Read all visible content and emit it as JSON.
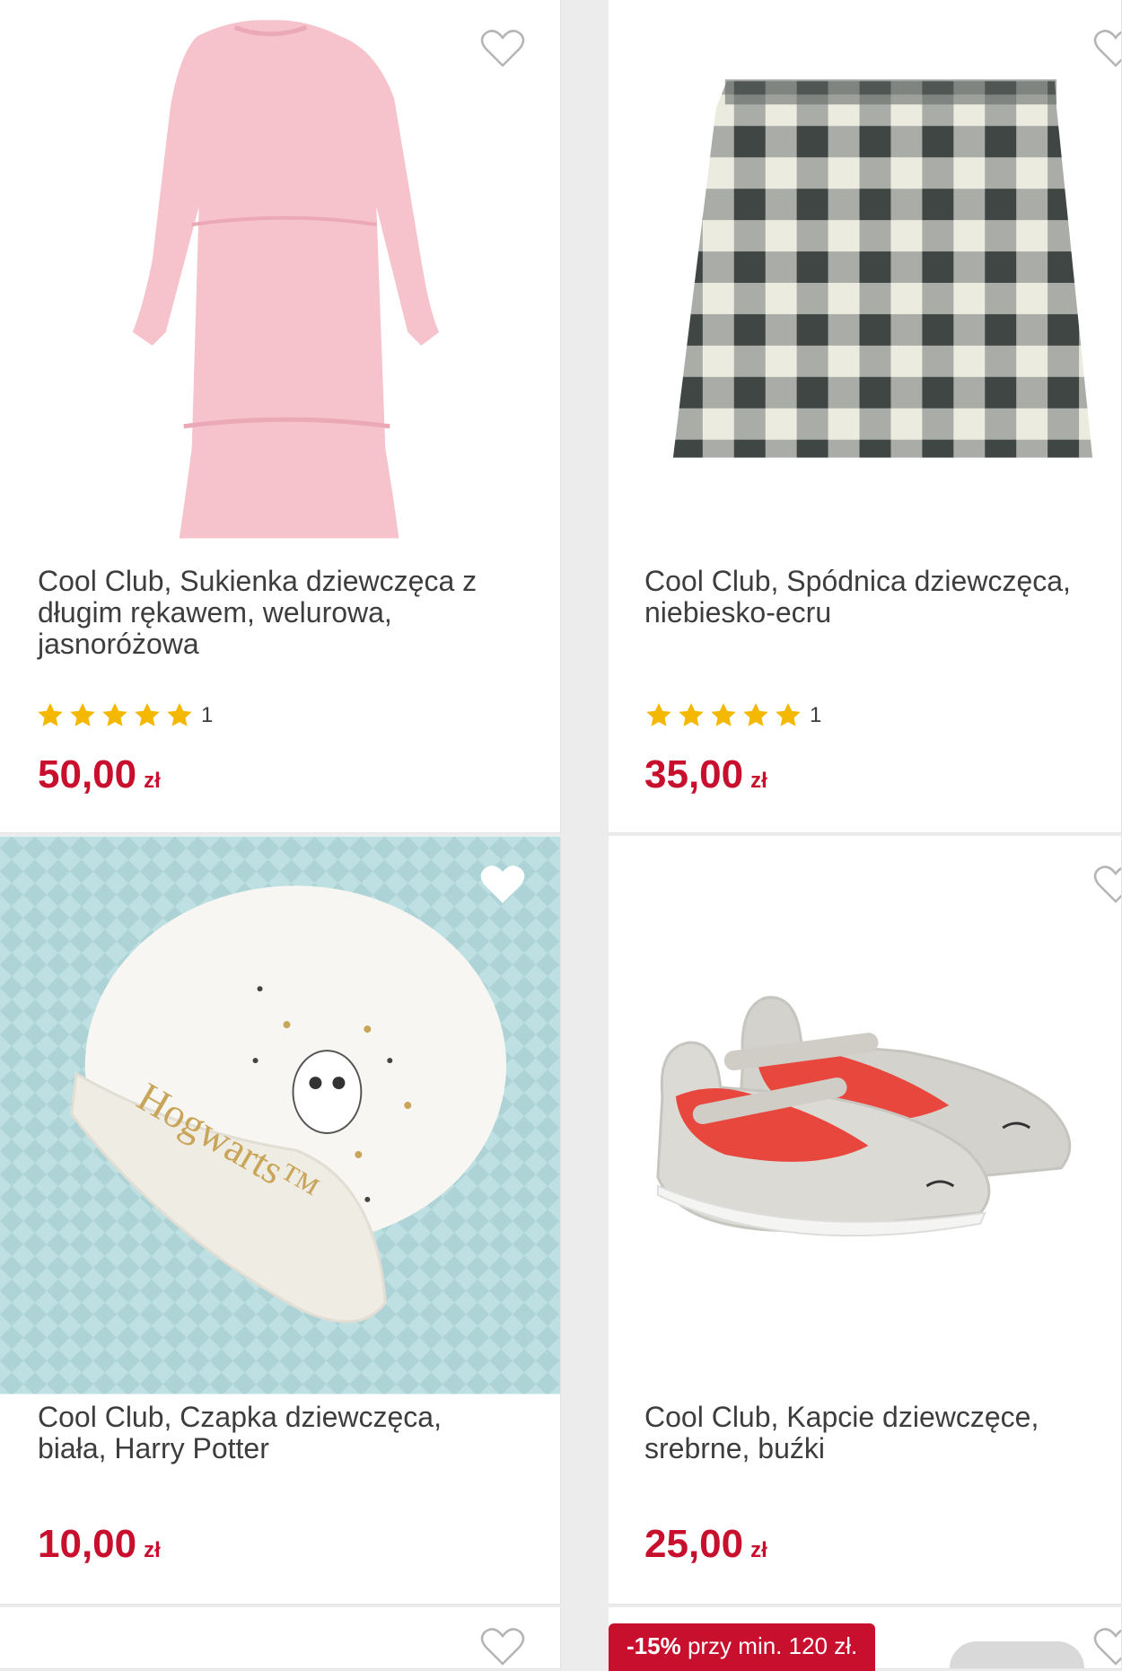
{
  "products": [
    {
      "title": "Cool Club, Sukienka dziewczęca z długim rękawem, welurowa, jasnoróżowa",
      "rating_count": "1",
      "price": "50,00",
      "currency": "zł"
    },
    {
      "title": "Cool Club, Spódnica dziewczęca, niebiesko-ecru",
      "rating_count": "1",
      "price": "35,00",
      "currency": "zł"
    },
    {
      "title": "Cool Club, Czapka dziewczęca, biała, Harry Potter",
      "price": "10,00",
      "currency": "zł",
      "image_text": "Hogwarts™"
    },
    {
      "title": "Cool Club, Kapcie dziewczęce, srebrne, buźki",
      "price": "25,00",
      "currency": "zł"
    }
  ],
  "promo": {
    "discount": "-15%",
    "text": "przy min. 120 zł."
  },
  "colors": {
    "price": "#c8102e",
    "star": "#f5b800",
    "promo_bg": "#c8102e"
  },
  "icons": [
    "heart-outline-icon",
    "star-icon"
  ]
}
